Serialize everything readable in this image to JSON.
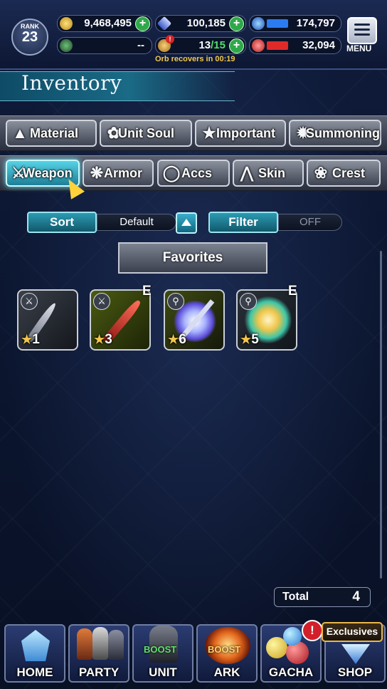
{
  "header": {
    "rank_label": "RANK",
    "rank_value": "23",
    "gil": "9,468,495",
    "lapis": "100,185",
    "blue_orb": "174,797",
    "green_meter": "--",
    "orbs": "13",
    "orbs_max": "/15",
    "red_orb": "32,094",
    "orb_note": "Orb recovers in 00:19",
    "menu_label": "MENU"
  },
  "page_title": "Inventory",
  "category_tabs": [
    {
      "label": "Material",
      "icon": "bag-icon"
    },
    {
      "label": "Unit Soul",
      "icon": "soul-icon"
    },
    {
      "label": "Important",
      "icon": "star-icon"
    },
    {
      "label": "Summoning",
      "icon": "dragon-icon"
    }
  ],
  "type_tabs": [
    {
      "label": "Weapon",
      "icon": "sword-icon",
      "active": true
    },
    {
      "label": "Armor",
      "icon": "armor-icon"
    },
    {
      "label": "Accs",
      "icon": "ring-icon"
    },
    {
      "label": "Skin",
      "icon": "hanger-icon"
    },
    {
      "label": "Crest",
      "icon": "crest-icon"
    }
  ],
  "controls": {
    "sort_label": "Sort",
    "sort_value": "Default",
    "filter_label": "Filter",
    "filter_value": "OFF",
    "favorites_label": "Favorites"
  },
  "items": [
    {
      "type": "sword",
      "rarity": "1",
      "equipped": false,
      "color": "#7f8696"
    },
    {
      "type": "sword",
      "rarity": "3",
      "equipped": true,
      "equipped_label": "E",
      "color": "#c8302c"
    },
    {
      "type": "staff",
      "rarity": "6",
      "equipped": false,
      "color": "#9aa4ff"
    },
    {
      "type": "staff",
      "rarity": "5",
      "equipped": true,
      "equipped_label": "E",
      "color": "#f0c64a"
    }
  ],
  "total": {
    "label": "Total",
    "value": "4"
  },
  "bottom_nav": [
    {
      "label": "HOME"
    },
    {
      "label": "PARTY"
    },
    {
      "label": "UNIT",
      "boost": "BOOST"
    },
    {
      "label": "ARK",
      "boost": "BOOST"
    },
    {
      "label": "GACHA",
      "alert": "!"
    },
    {
      "label": "SHOP",
      "tag": "Exclusives"
    }
  ]
}
